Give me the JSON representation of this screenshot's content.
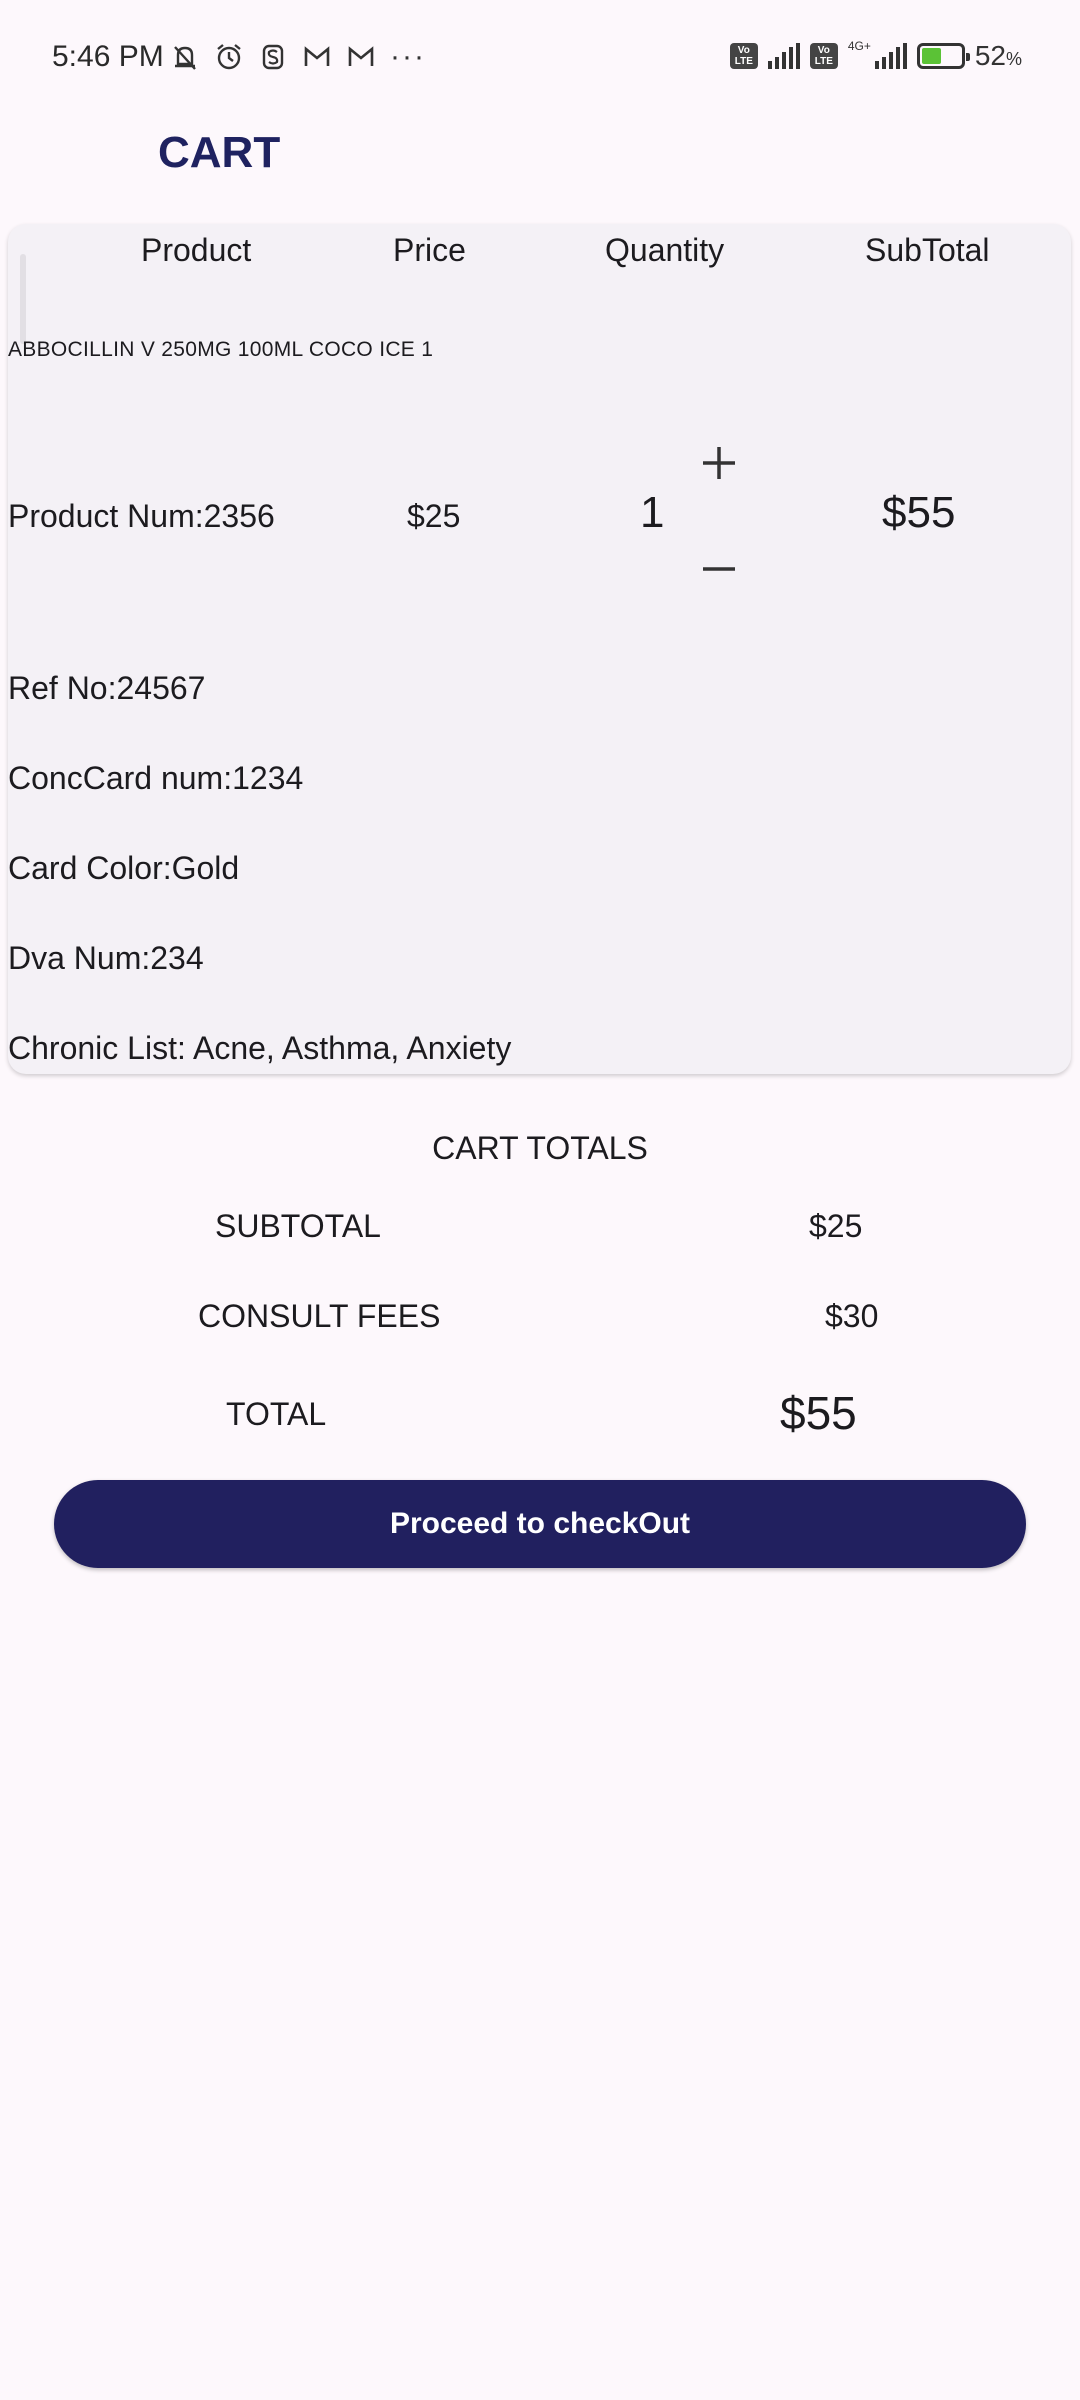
{
  "status_bar": {
    "time": "5:46 PM",
    "left_icons": [
      "muted-bell-icon",
      "alarm-icon",
      "s-app-icon",
      "gmail-icon",
      "gmail-icon"
    ],
    "more": "···",
    "network": "4G+",
    "battery_pct": "52",
    "battery_unit": "%"
  },
  "app_bar": {
    "title": "CART"
  },
  "table": {
    "headers": [
      "Product",
      "Price",
      "Quantity",
      "SubTotal"
    ],
    "item": {
      "name": "ABBOCILLIN V 250MG 100ML COCO ICE 1",
      "product_num": "Product Num:2356",
      "price": "$25",
      "quantity": "1",
      "plus": "+",
      "minus": "−",
      "subtotal": "$55",
      "details": [
        "Ref No:24567",
        "ConcCard num:1234",
        "Card Color:Gold",
        "Dva Num:234",
        "Chronic List: Acne, Asthma, Anxiety"
      ]
    }
  },
  "totals": {
    "title": "CART TOTALS",
    "subtotal_label": "SUBTOTAL",
    "subtotal_value": "$25",
    "fees_label": "CONSULT FEES",
    "fees_value": "$30",
    "total_label": "TOTAL",
    "total_value": "$55"
  },
  "checkout": {
    "label": "Proceed to checkOut"
  },
  "colors": {
    "accent": "#21205f",
    "background": "#fdf8fc",
    "card": "#f4f1f6"
  }
}
